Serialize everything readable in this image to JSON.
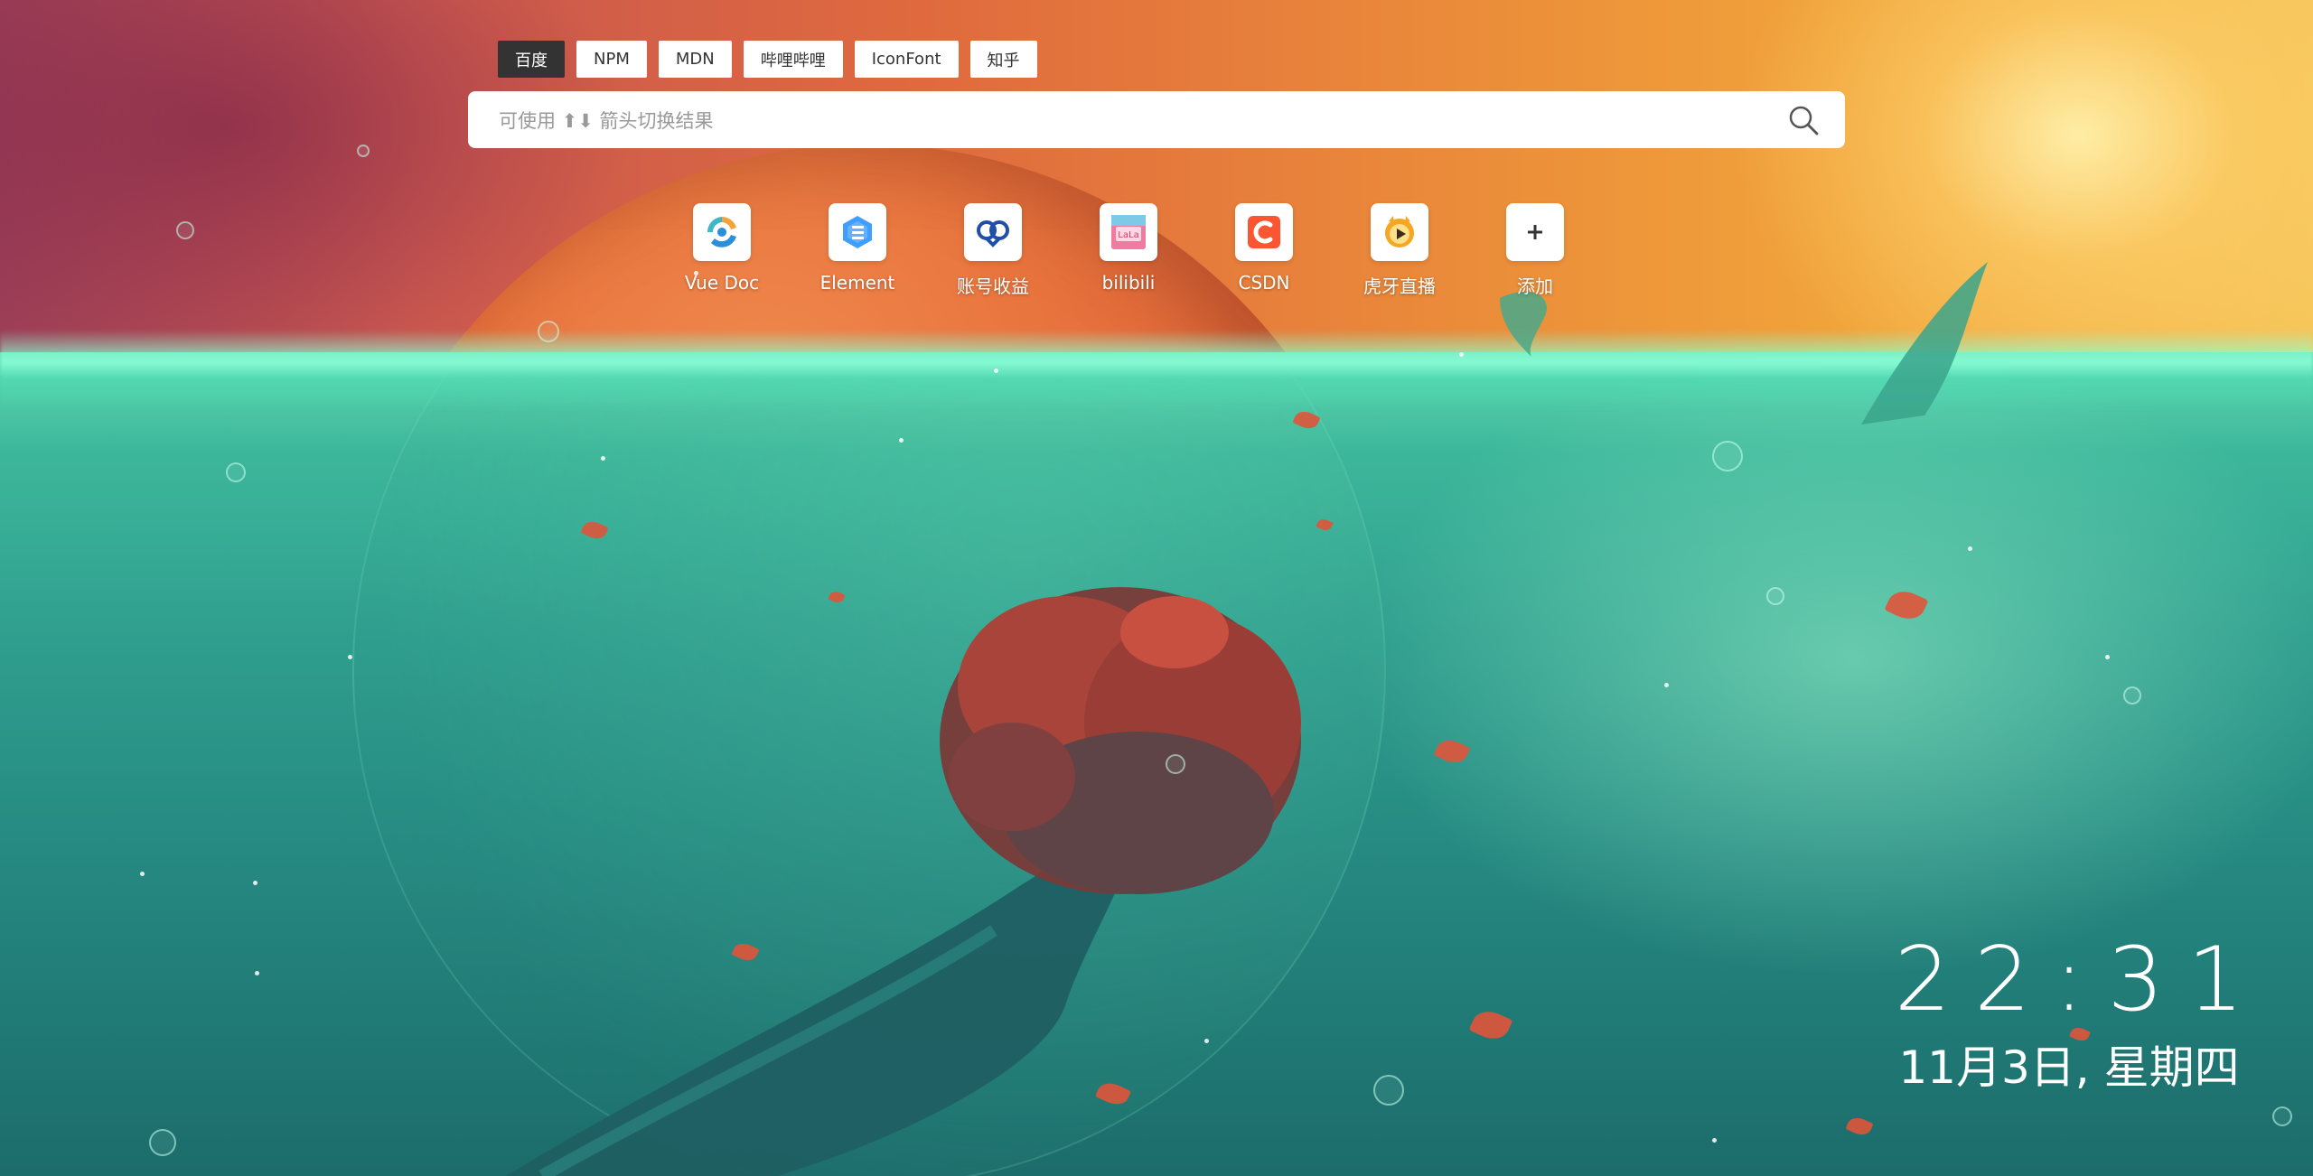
{
  "engines": [
    {
      "label": "百度",
      "active": true
    },
    {
      "label": "NPM",
      "active": false
    },
    {
      "label": "MDN",
      "active": false
    },
    {
      "label": "哔哩哔哩",
      "active": false
    },
    {
      "label": "IconFont",
      "active": false
    },
    {
      "label": "知乎",
      "active": false
    }
  ],
  "search": {
    "placeholder": "可使用 ⬆⬇ 箭头切换结果",
    "value": "",
    "icon": "search-icon"
  },
  "shortcuts": [
    {
      "label": "Vue Doc",
      "icon": "vue-doc-icon"
    },
    {
      "label": "Element",
      "icon": "element-icon"
    },
    {
      "label": "账号收益",
      "icon": "account-revenue-icon"
    },
    {
      "label": "bilibili",
      "icon": "bilibili-icon"
    },
    {
      "label": "CSDN",
      "icon": "csdn-icon"
    },
    {
      "label": "虎牙直播",
      "icon": "huya-icon"
    },
    {
      "label": "添加",
      "icon": "plus-icon"
    }
  ],
  "clock": {
    "time": "22:31",
    "date": "11月3日, 星期四"
  },
  "colors": {
    "active_tab_bg": "#333333",
    "tab_bg": "#ffffff",
    "sea": "#2f9e8e",
    "sky": "#e06a3e"
  }
}
